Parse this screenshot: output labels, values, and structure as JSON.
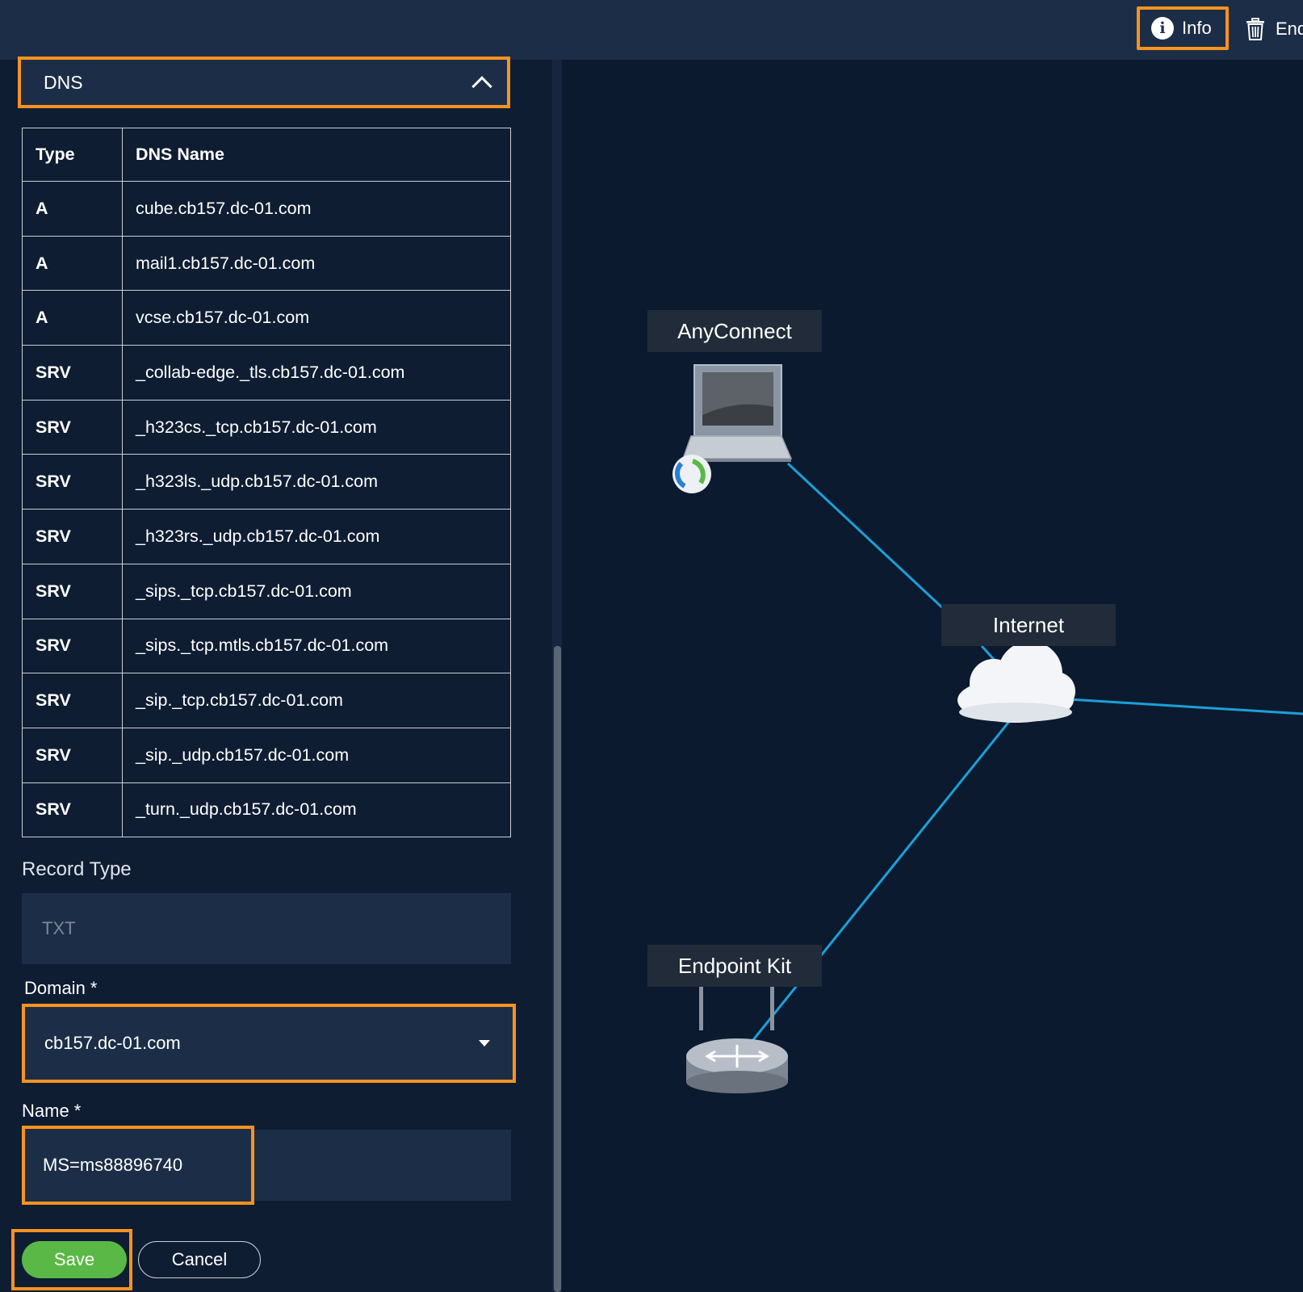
{
  "topbar": {
    "info_label": "Info",
    "end_label": "End"
  },
  "dns_panel": {
    "title": "DNS",
    "table": {
      "headers": [
        "Type",
        "DNS Name"
      ],
      "rows": [
        {
          "type": "A",
          "name": "cube.cb157.dc-01.com"
        },
        {
          "type": "A",
          "name": "mail1.cb157.dc-01.com"
        },
        {
          "type": "A",
          "name": "vcse.cb157.dc-01.com"
        },
        {
          "type": "SRV",
          "name": "_collab-edge._tls.cb157.dc-01.com"
        },
        {
          "type": "SRV",
          "name": "_h323cs._tcp.cb157.dc-01.com"
        },
        {
          "type": "SRV",
          "name": "_h323ls._udp.cb157.dc-01.com"
        },
        {
          "type": "SRV",
          "name": "_h323rs._udp.cb157.dc-01.com"
        },
        {
          "type": "SRV",
          "name": "_sips._tcp.cb157.dc-01.com"
        },
        {
          "type": "SRV",
          "name": "_sips._tcp.mtls.cb157.dc-01.com"
        },
        {
          "type": "SRV",
          "name": "_sip._tcp.cb157.dc-01.com"
        },
        {
          "type": "SRV",
          "name": "_sip._udp.cb157.dc-01.com"
        },
        {
          "type": "SRV",
          "name": "_turn._udp.cb157.dc-01.com"
        }
      ]
    }
  },
  "form": {
    "record_type_label": "Record Type",
    "record_type_value": "TXT",
    "domain_label": "Domain *",
    "domain_value": "cb157.dc-01.com",
    "name_label": "Name *",
    "name_value": "MS=ms88896740",
    "save_label": "Save",
    "cancel_label": "Cancel"
  },
  "topology": {
    "nodes": {
      "anyconnect": "AnyConnect",
      "internet": "Internet",
      "endpoint_kit": "Endpoint Kit"
    },
    "link_color": "#1ca0d8"
  },
  "colors": {
    "highlight": "#f7931e",
    "save_green": "#5ab946",
    "panel_bg": "#0f1d33",
    "field_bg": "#1c2e47"
  }
}
